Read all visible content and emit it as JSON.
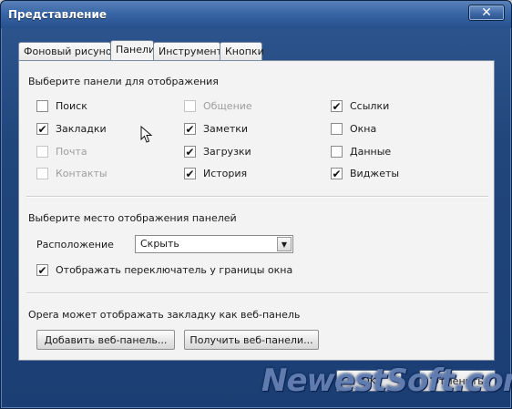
{
  "window": {
    "title": "Представление",
    "close_glyph": "✕"
  },
  "tabs": [
    {
      "label": "Фоновый рисунок",
      "active": false
    },
    {
      "label": "Панели",
      "active": true
    },
    {
      "label": "Инструменты",
      "active": false
    },
    {
      "label": "Кнопки",
      "active": false
    }
  ],
  "panels_section": {
    "title": "Выберите панели для отображения",
    "checkboxes": [
      {
        "label": "Поиск",
        "checked": false,
        "enabled": true
      },
      {
        "label": "Закладки",
        "checked": true,
        "enabled": true
      },
      {
        "label": "Почта",
        "checked": false,
        "enabled": false
      },
      {
        "label": "Контакты",
        "checked": false,
        "enabled": false
      },
      {
        "label": "Общение",
        "checked": false,
        "enabled": false
      },
      {
        "label": "Заметки",
        "checked": true,
        "enabled": true
      },
      {
        "label": "Загрузки",
        "checked": true,
        "enabled": true
      },
      {
        "label": "История",
        "checked": true,
        "enabled": true
      },
      {
        "label": "Ссылки",
        "checked": true,
        "enabled": true
      },
      {
        "label": "Окна",
        "checked": false,
        "enabled": true
      },
      {
        "label": "Данные",
        "checked": false,
        "enabled": true
      },
      {
        "label": "Виджеты",
        "checked": true,
        "enabled": true
      }
    ]
  },
  "placement_section": {
    "title": "Выберите место отображения панелей",
    "position_label": "Расположение",
    "position_value": "Скрыть",
    "toggle_label": "Отображать переключатель у границы окна",
    "toggle_checked": true
  },
  "webpanel_section": {
    "title": "Opera может отображать закладку как веб-панель",
    "add_button": "Добавить веб-панель...",
    "get_button": "Получить веб-панели..."
  },
  "footer": {
    "ok_label": "OK",
    "cancel_label": "Отменить"
  },
  "watermark": "NewestSoft.com",
  "check_glyph": "✔"
}
